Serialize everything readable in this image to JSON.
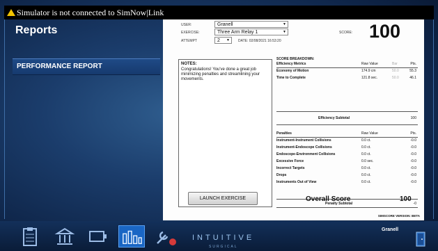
{
  "warning": {
    "text": "Simulator is not connected to SimNow|Link"
  },
  "left_panel": {
    "title": "Reports",
    "items": [
      {
        "label": "PERFORMANCE REPORT"
      }
    ]
  },
  "report": {
    "user_label": "USER:",
    "user_value": "Granell",
    "exercise_label": "EXERCISE:",
    "exercise_value": "Three Arm Relay 1",
    "attempt_label": "ATTEMPT",
    "attempt_value": "2",
    "date_label": "DATE: 02/08/2021 16:53:20",
    "score_label": "SCORE:",
    "score_value": "100",
    "notes_title": "NOTES:",
    "notes_body": "Congratulations! You've done a great job minimizing penalties and streamlining your movements.",
    "breakdown_title": "SCORE BREAKDOWN:",
    "efficiency_header": {
      "name": "Efficiency Metrics",
      "raw": "Raw Value",
      "mid": "Bar",
      "pts": "Pts."
    },
    "efficiency_rows": [
      {
        "name": "Economy of Motion",
        "raw": "174.9 cm",
        "mid": "50.0",
        "pts": "55.3"
      },
      {
        "name": "Time to Complete",
        "raw": "121.8 sec.",
        "mid": "50.0",
        "pts": "46.1"
      }
    ],
    "efficiency_subtotal": {
      "label": "Efficiency Subtotal",
      "value": "100"
    },
    "penalty_header": {
      "name": "Penalties",
      "raw": "Raw Value",
      "pts": "Pts."
    },
    "penalty_rows": [
      {
        "name": "Instrument-Instrument Collisions",
        "raw": "0.0 ct.",
        "pts": "-0.0"
      },
      {
        "name": "Instrument-Endoscope Collisions",
        "raw": "0.0 ct.",
        "pts": "-0.0"
      },
      {
        "name": "Endoscope-Environment Collisions",
        "raw": "0.0 ct.",
        "pts": "-0.0"
      },
      {
        "name": "Excessive Force",
        "raw": "0.0 sec.",
        "pts": "-0.0"
      },
      {
        "name": "Incorrect Targets",
        "raw": "0.0 ct.",
        "pts": "-0.0"
      },
      {
        "name": "Drops",
        "raw": "0.0 ct.",
        "pts": "-0.0"
      },
      {
        "name": "Instruments Out of View",
        "raw": "0.0 ct.",
        "pts": "-0.0"
      }
    ],
    "penalty_subtotal": {
      "label": "Penalty Subtotal",
      "value": "-0"
    },
    "launch_label": "LAUNCH EXERCISE",
    "overall_label": "Overall Score",
    "overall_value": "100",
    "simscore_version": "SIMSCORE VERSION: BETA"
  },
  "taskbar": {
    "brand": "INTUITIVE",
    "brand_sub": "SURGICAL",
    "user": "Granell",
    "icons": [
      "clipboard-icon",
      "museum-icon",
      "battery-icon",
      "reports-icon",
      "tools-icon",
      "exit-icon"
    ],
    "active_color": "#1a66c4"
  }
}
